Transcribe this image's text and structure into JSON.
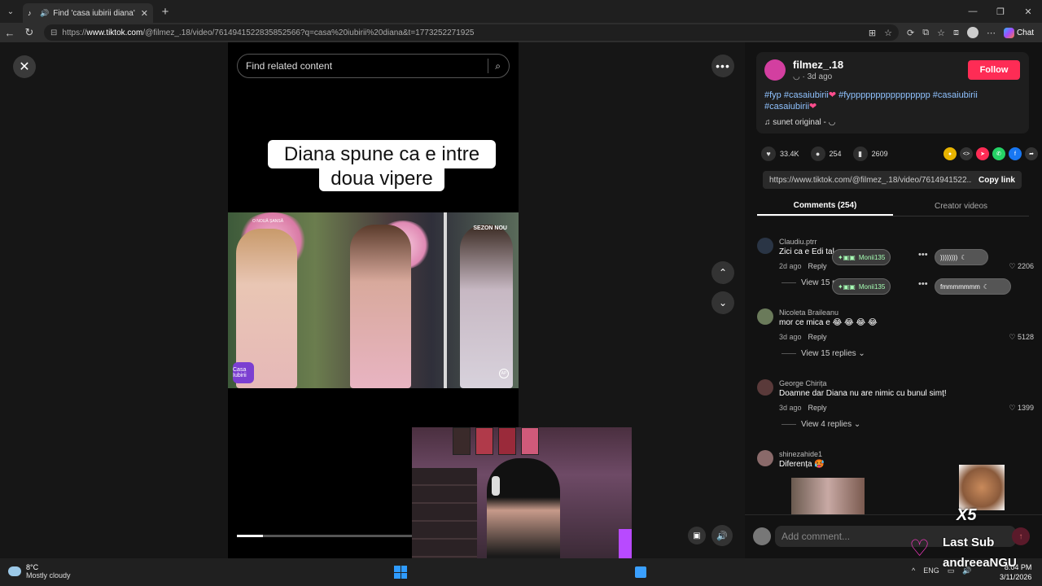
{
  "browser": {
    "tab_title": "Find 'casa iubirii diana' on TikTok",
    "tab_title_visible": "Find 'casa iubirii diana' on Tik",
    "url_prefix": "https://",
    "url_domain": "www.tiktok.com",
    "url_rest": "/@filmez_.18/video/7614941522835852566?q=casa%20iubirii%20diana&t=1773252271925",
    "copilot_label": "Chat"
  },
  "video": {
    "search_placeholder": "Find related content",
    "caption_line1": "Diana spune ca e intre",
    "caption_line2": "doua vipere",
    "frame_top_label": "O NOUĂ ȘANSĂ",
    "frame_sezon": "SEZON NOU",
    "frame_logo": "Casa Iubirii",
    "progress": 0.14
  },
  "post": {
    "author": "filmez_.18",
    "time": "3d ago",
    "follow_label": "Follow",
    "hashtags": "#fyp #casaiubirii",
    "hashtags_2": "#fypppppppppppppppp #casaiubirii",
    "hashtags_3": "#casaiubirii",
    "sound": "sunet original -",
    "likes": "33.4K",
    "comments": "254",
    "saves": "2609",
    "link": "https://www.tiktok.com/@filmez_.18/video/7614941522...",
    "copy_link_label": "Copy link"
  },
  "tabs": {
    "comments": "Comments (254)",
    "creator": "Creator videos"
  },
  "comments": [
    {
      "user": "Claudiu.ptrr",
      "text": "Zici ca e Edi tal",
      "time": "2d ago",
      "reply": "Reply",
      "likes": "2206",
      "replies": "View 15 r"
    },
    {
      "user": "Nicoleta Braileanu",
      "text": "mor ce mica e 😂 😂 😂 😂",
      "time": "3d ago",
      "reply": "Reply",
      "likes": "5128",
      "replies": "View 15 replies ⌄"
    },
    {
      "user": "George Chirița",
      "text": "Doamne dar Diana nu are nimic cu bunul simț!",
      "time": "3d ago",
      "reply": "Reply",
      "likes": "1399",
      "replies": "View 4 replies ⌄"
    },
    {
      "user": "shinezahide1",
      "text": "Diferența 🥵",
      "time": "",
      "reply": "",
      "likes": "",
      "replies": ""
    }
  ],
  "overlay": {
    "pill1_name": "Monii135",
    "pill1_right": "))))))))",
    "pill2_name": "Monii135",
    "pill2_right": "fmmmmmmm"
  },
  "add_comment": {
    "placeholder": "Add comment..."
  },
  "stream": {
    "multiplier": "X5",
    "last_sub_label": "Last Sub",
    "last_sub_name": "andreeaNGU"
  },
  "taskbar": {
    "temp": "8°C",
    "weather": "Mostly cloudy",
    "lang": "ENG",
    "time": "8:04 PM",
    "date": "3/11/2026"
  },
  "colors": {
    "follow": "#fe2c55",
    "hashtag": "#8fc2ff",
    "accent_pink": "#ff3ac8"
  }
}
